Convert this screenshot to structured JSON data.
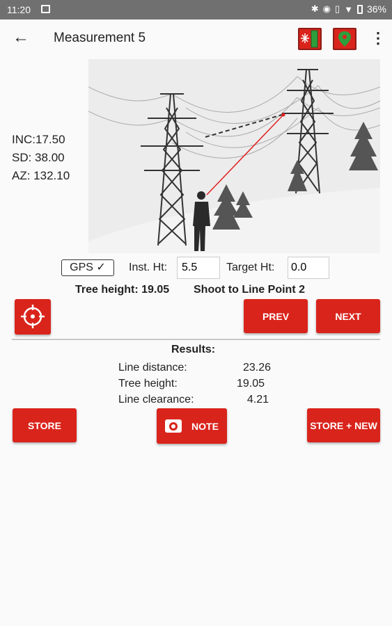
{
  "status_bar": {
    "time": "11:20",
    "battery": "36%",
    "icons": [
      "image-icon",
      "bluetooth-icon",
      "location-icon",
      "vibrate-icon",
      "wifi-icon",
      "battery-icon"
    ]
  },
  "app_bar": {
    "title": "Measurement 5",
    "back_icon": "arrow-left-icon",
    "laser_icon": "laser-icon",
    "gps_icon": "map-pin-icon",
    "menu_icon": "more-vert-icon"
  },
  "readings": {
    "inc": "INC:17.50",
    "sd": "SD:  38.00",
    "az": "AZ:  132.10"
  },
  "controls": {
    "gps_label": "GPS ✓",
    "inst_ht_label": "Inst. Ht:",
    "inst_ht_value": "5.5",
    "target_ht_label": "Target Ht:",
    "target_ht_value": "0.0",
    "tree_height": "Tree height: 19.05",
    "shoot_label": "Shoot to Line Point 2"
  },
  "buttons": {
    "prev": "PREV",
    "next": "NEXT",
    "store": "STORE",
    "note": "NOTE",
    "store_new": "STORE + NEW"
  },
  "results": {
    "title": "Results:",
    "rows": [
      {
        "label": "Line distance:",
        "value": "23.26"
      },
      {
        "label": "Tree height:",
        "value": "19.05"
      },
      {
        "label": "Line clearance:",
        "value": "4.21"
      }
    ]
  },
  "colors": {
    "accent": "#d9241c",
    "status_bar": "#707070",
    "gps_green": "#2e9e3c"
  }
}
